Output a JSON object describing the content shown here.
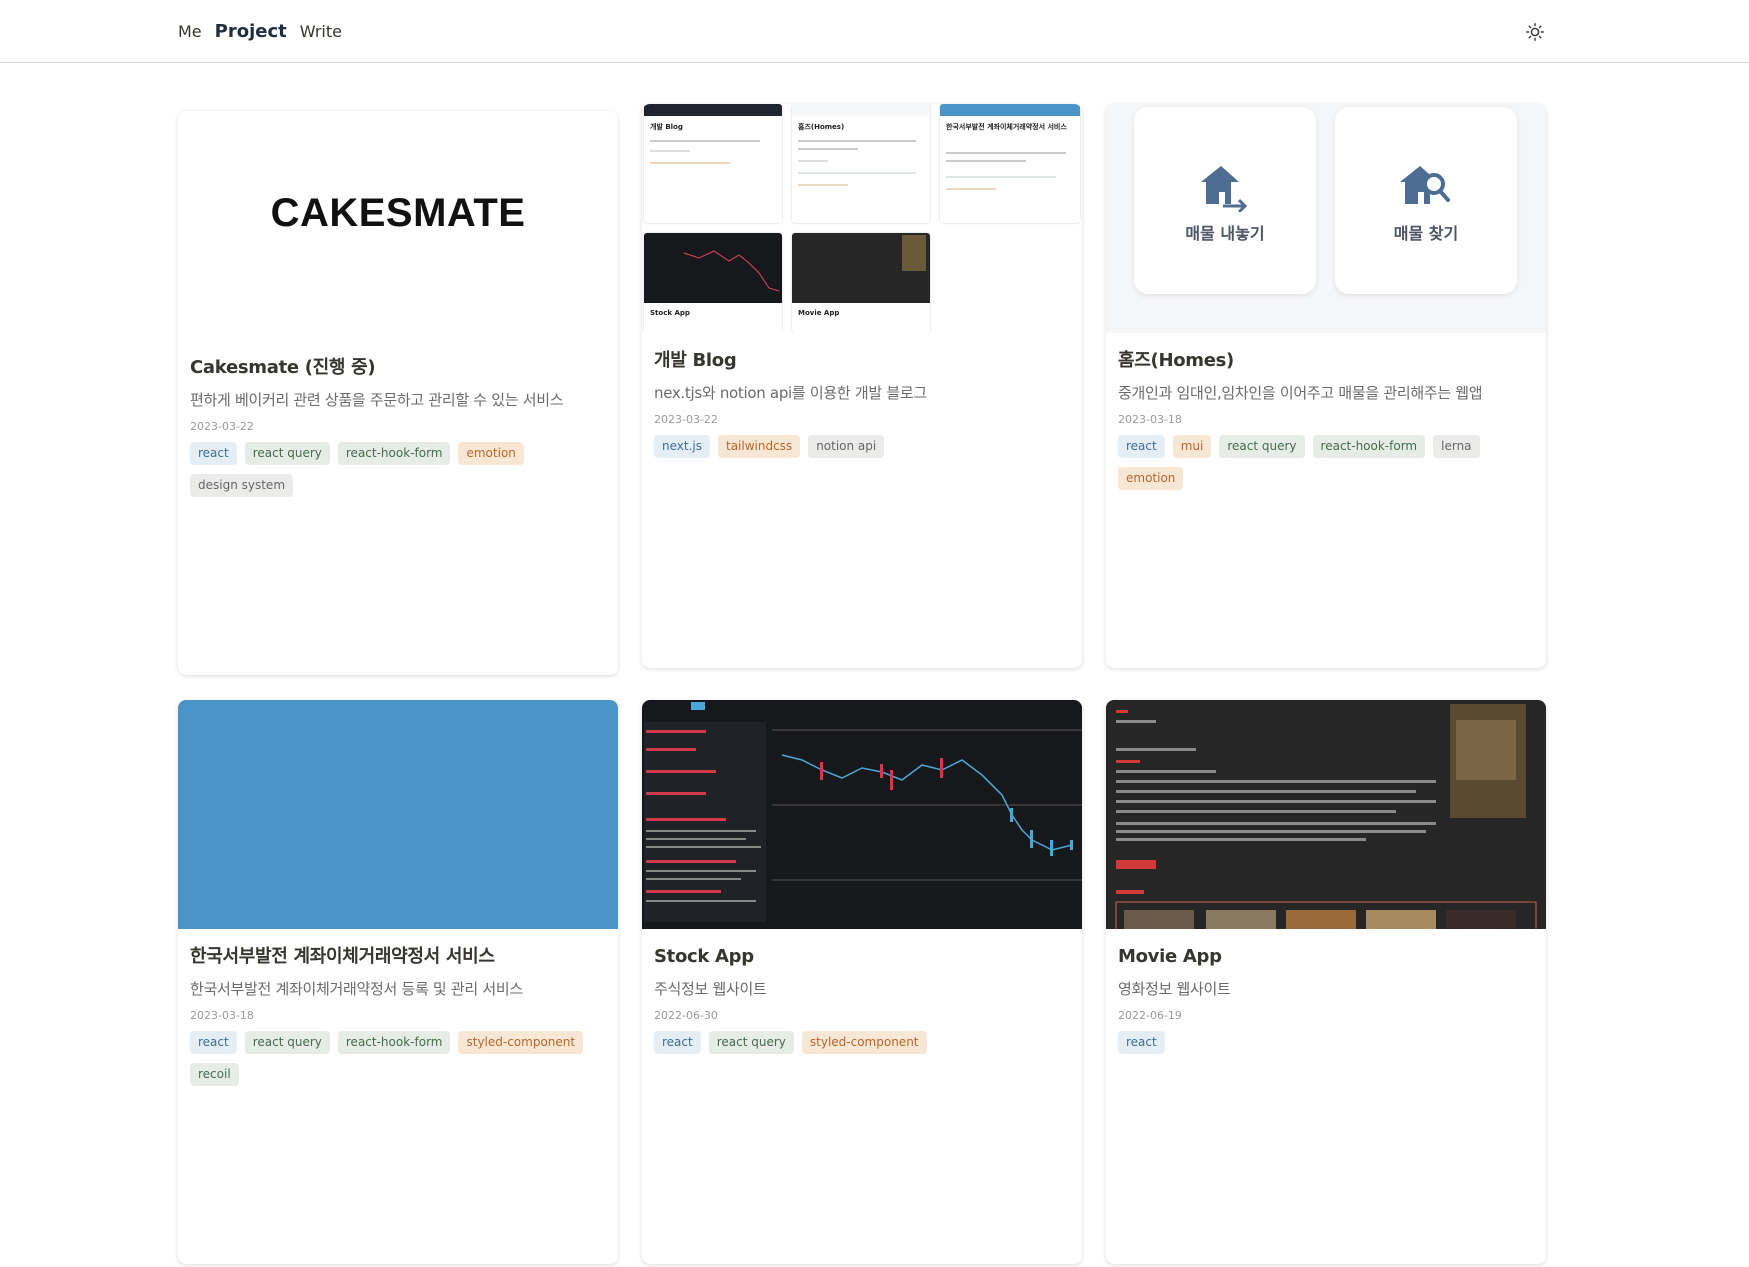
{
  "nav": {
    "me": "Me",
    "project": "Project",
    "write": "Write",
    "theme_icon": "sun-icon"
  },
  "thumbs": {
    "cakesmate_logo": "CAKESMATE",
    "homes_sell": "매물 내놓기",
    "homes_find": "매물 찾기",
    "collage": {
      "blog_title": "개발 Blog",
      "homes_title": "홈즈(Homes)",
      "wp_title": "한국서부발전 계좌이체거래약정서 서비스",
      "stock_title": "Stock App",
      "movie_title": "Movie App"
    }
  },
  "projects": [
    {
      "title": "Cakesmate (진행 중)",
      "desc": "편하게 베이커리 관련 상품을 주문하고 관리할 수 있는 서비스",
      "date": "2023-03-22",
      "tags": [
        {
          "label": "react",
          "color": "blue"
        },
        {
          "label": "react query",
          "color": "green"
        },
        {
          "label": "react-hook-form",
          "color": "green"
        },
        {
          "label": "emotion",
          "color": "orange"
        },
        {
          "label": "design system",
          "color": "grey"
        }
      ]
    },
    {
      "title": "개발 Blog",
      "desc": "nex.tjs와 notion api를 이용한 개발 블로그",
      "date": "2023-03-22",
      "tags": [
        {
          "label": "next.js",
          "color": "blue"
        },
        {
          "label": "tailwindcss",
          "color": "orange"
        },
        {
          "label": "notion api",
          "color": "grey"
        }
      ]
    },
    {
      "title": "홈즈(Homes)",
      "desc": "중개인과 임대인,임차인을 이어주고 매물을 관리해주는 웹앱",
      "date": "2023-03-18",
      "tags": [
        {
          "label": "react",
          "color": "blue"
        },
        {
          "label": "mui",
          "color": "orange"
        },
        {
          "label": "react query",
          "color": "green"
        },
        {
          "label": "react-hook-form",
          "color": "green"
        },
        {
          "label": "lerna",
          "color": "grey"
        },
        {
          "label": "emotion",
          "color": "orange"
        }
      ]
    },
    {
      "title": "한국서부발전 계좌이체거래약정서 서비스",
      "desc": "한국서부발전 계좌이체거래약정서 등록 및 관리 서비스",
      "date": "2023-03-18",
      "tags": [
        {
          "label": "react",
          "color": "blue"
        },
        {
          "label": "react query",
          "color": "green"
        },
        {
          "label": "react-hook-form",
          "color": "green"
        },
        {
          "label": "styled-component",
          "color": "orange"
        },
        {
          "label": "recoil",
          "color": "green"
        }
      ]
    },
    {
      "title": "Stock App",
      "desc": "주식정보 웹사이트",
      "date": "2022-06-30",
      "tags": [
        {
          "label": "react",
          "color": "blue"
        },
        {
          "label": "react query",
          "color": "green"
        },
        {
          "label": "styled-component",
          "color": "orange"
        }
      ]
    },
    {
      "title": "Movie App",
      "desc": "영화정보 웹사이트",
      "date": "2022-06-19",
      "tags": [
        {
          "label": "react",
          "color": "blue"
        }
      ]
    }
  ],
  "colors": {
    "accent_blue": "#4a94ca",
    "nav_active": "#1f2d3d",
    "house_icon": "#4d6d93"
  }
}
